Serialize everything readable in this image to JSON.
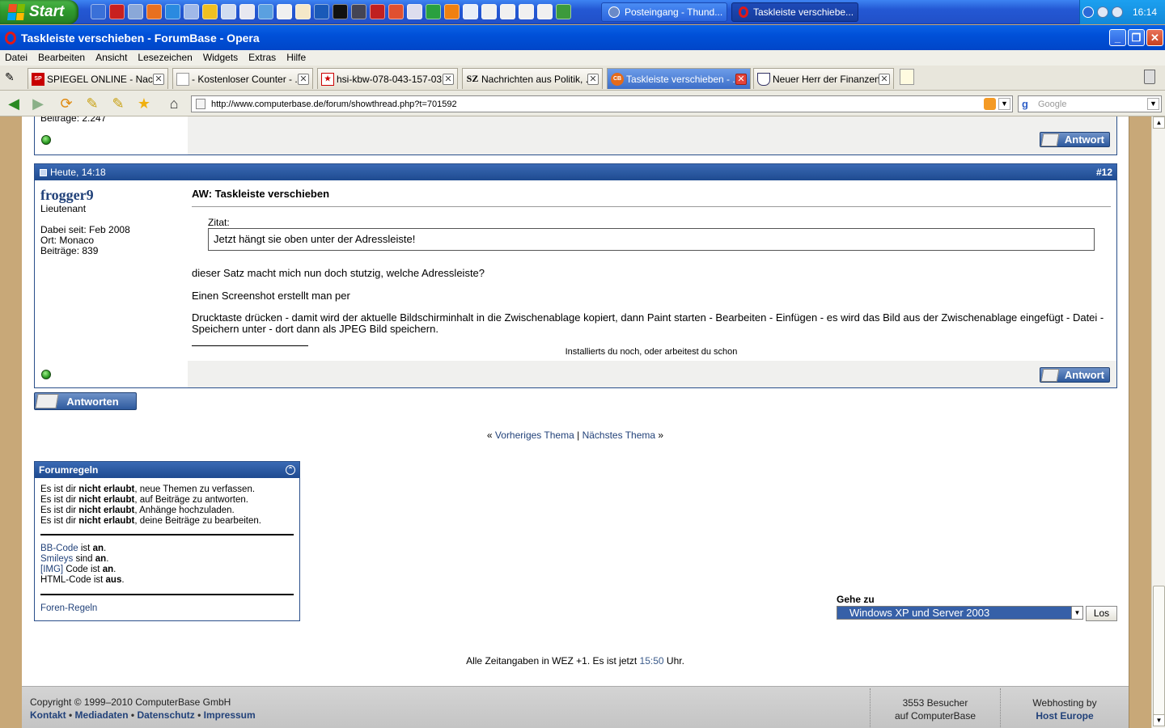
{
  "taskbar": {
    "start_label": "Start",
    "tasks": [
      {
        "label": "Posteingang - Thund...",
        "icon": "thunderbird-icon"
      },
      {
        "label": "Taskleiste verschiebe...",
        "icon": "opera-icon"
      }
    ],
    "clock": "16:14"
  },
  "window": {
    "title": "Taskleiste verschieben - ForumBase - Opera",
    "minimize": "_",
    "maximize": "❐",
    "close": "✕"
  },
  "menu": [
    "Datei",
    "Bearbeiten",
    "Ansicht",
    "Lesezeichen",
    "Widgets",
    "Extras",
    "Hilfe"
  ],
  "tabs": [
    {
      "label": "SPIEGEL ONLINE - Nachr...",
      "fav": "SP",
      "active": false
    },
    {
      "label": "- Kostenloser Counter - ...",
      "fav": "",
      "active": false
    },
    {
      "label": "hsi-kbw-078-043-157-03...",
      "fav": "★",
      "active": false
    },
    {
      "label": "Nachrichten aus Politik, ...",
      "fav": "SZ",
      "active": false
    },
    {
      "label": "Taskleiste verschieben - ...",
      "fav": "CB",
      "active": true
    },
    {
      "label": "Neuer Herr der Finanzen...",
      "fav": "",
      "active": false
    }
  ],
  "address": {
    "url": "http://www.computerbase.de/forum/showthread.php?t=701592",
    "search_placeholder": "Google"
  },
  "prev_post": {
    "beitraege": "Beiträge: 2.247",
    "reply_label": "Antwort"
  },
  "post": {
    "date": "Heute, 14:18",
    "number": "#12",
    "author": "frogger9",
    "rank": "Lieutenant",
    "joined": "Dabei seit: Feb 2008",
    "location": "Ort: Monaco",
    "posts": "Beiträge: 839",
    "subject": "AW: Taskleiste verschieben",
    "quote_label": "Zitat:",
    "quote_text": "Jetzt hängt sie oben unter der Adressleiste!",
    "para1": "dieser Satz macht mich nun doch stutzig, welche Adressleiste?",
    "para2": "Einen Screenshot erstellt man per",
    "para3": "Drucktaste drücken - damit wird der aktuelle Bildschirminhalt in die Zwischenablage kopiert, dann Paint starten - Bearbeiten - Einfügen - es wird das Bild aus der Zwischenablage eingefügt - Datei - Speichern unter - dort dann als JPEG Bild speichern.",
    "signature": "Installierts du noch, oder arbeitest du schon",
    "reply_label": "Antwort"
  },
  "antworten_label": "Antworten",
  "thread_nav": {
    "left": "«",
    "prev": "Vorheriges Thema",
    "sep": "|",
    "next": "Nächstes Thema",
    "right": "»"
  },
  "rules": {
    "title": "Forumregeln",
    "lines": [
      {
        "pre": "Es ist dir ",
        "bold": "nicht erlaubt",
        "post": ", neue Themen zu verfassen."
      },
      {
        "pre": "Es ist dir ",
        "bold": "nicht erlaubt",
        "post": ", auf Beiträge zu antworten."
      },
      {
        "pre": "Es ist dir ",
        "bold": "nicht erlaubt",
        "post": ", Anhänge hochzuladen."
      },
      {
        "pre": "Es ist dir ",
        "bold": "nicht erlaubt",
        "post": ", deine Beiträge zu bearbeiten."
      }
    ],
    "codes": [
      {
        "link": "BB-Code",
        "mid": " ist ",
        "bold": "an",
        "post": "."
      },
      {
        "link": "Smileys",
        "mid": " sind ",
        "bold": "an",
        "post": "."
      },
      {
        "link": "[IMG]",
        "mid": " Code ist ",
        "bold": "an",
        "post": "."
      },
      {
        "link": "",
        "mid": "HTML-Code ist ",
        "bold": "aus",
        "post": "."
      }
    ],
    "foren_regeln": "Foren-Regeln"
  },
  "goto": {
    "label": "Gehe zu",
    "selected": "Windows XP und Server 2003",
    "button": "Los"
  },
  "time_line": {
    "pre": "Alle Zeitangaben in WEZ +1. Es ist jetzt ",
    "time": "15:50",
    "post": " Uhr."
  },
  "footer": {
    "copyright": "Copyright © 1999–2010 ComputerBase GmbH",
    "links": [
      "Kontakt",
      "Mediadaten",
      "Datenschutz",
      "Impressum"
    ],
    "visitors_line1": "3553 Besucher",
    "visitors_line2": "auf ComputerBase",
    "hosting_label": "Webhosting by",
    "hosting_link": "Host Europe"
  },
  "colors": {
    "taskbar": "#2458d4",
    "post_header": "#1e4a90",
    "link": "#22427a",
    "page_bg": "#c8a878"
  }
}
